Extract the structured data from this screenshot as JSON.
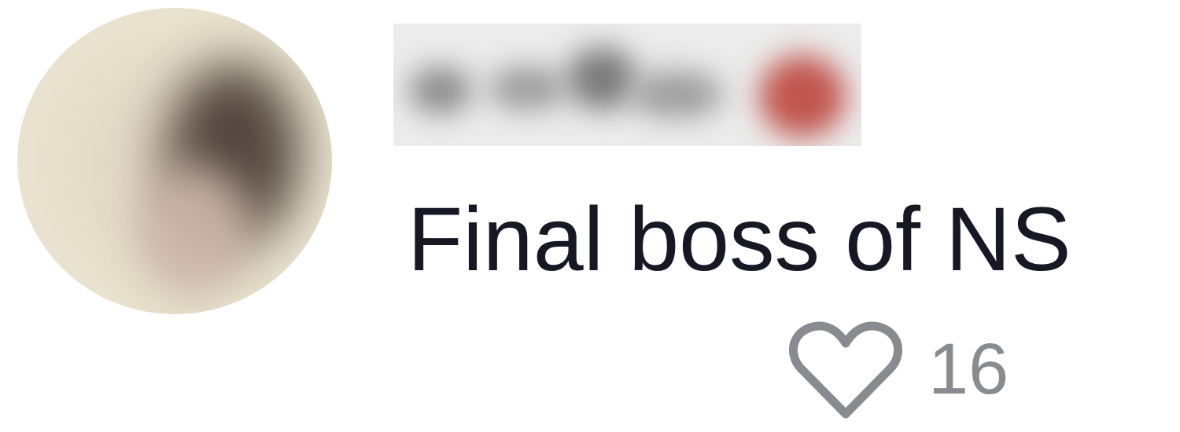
{
  "comment": {
    "text": "Final boss of NS",
    "likes": {
      "icon": "heart-outline-icon",
      "count": "16",
      "liked": false
    }
  },
  "colors": {
    "text": "#161823",
    "secondary": "#8a8b91"
  }
}
